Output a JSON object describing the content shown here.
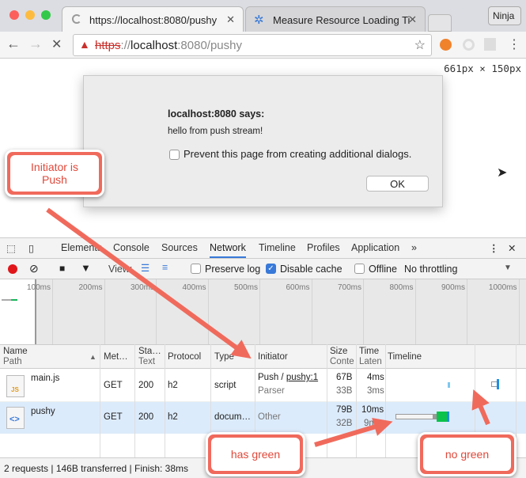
{
  "browser": {
    "tabs": [
      {
        "title": "https://localhost:8080/pushy"
      },
      {
        "title": "Measure Resource Loading Ti"
      }
    ],
    "profile": "Ninja",
    "url": {
      "scheme": "https",
      "host": "localhost",
      "rest": ":8080/pushy"
    },
    "viewport_size": "661px × 150px"
  },
  "dialog": {
    "title": "localhost:8080 says:",
    "message": "hello from push stream!",
    "checkbox_label": "Prevent this page from creating additional dialogs.",
    "ok": "OK"
  },
  "devtools": {
    "tabs": [
      "Elements",
      "Console",
      "Sources",
      "Network",
      "Timeline",
      "Profiles",
      "Application"
    ],
    "active_tab": "Network",
    "more": "»",
    "toolbar": {
      "view": "View:",
      "preserve_log": "Preserve log",
      "disable_cache": "Disable cache",
      "offline": "Offline",
      "throttling": "No throttling",
      "disable_cache_checked": true
    },
    "ticks": [
      "100ms",
      "200ms",
      "300ms",
      "400ms",
      "500ms",
      "600ms",
      "700ms",
      "800ms",
      "900ms",
      "1000ms"
    ],
    "columns": {
      "name": "Name",
      "path": "Path",
      "method": "Met…",
      "status": "Sta…",
      "status_text": "Text",
      "protocol": "Protocol",
      "type": "Type",
      "initiator": "Initiator",
      "size": "Size",
      "content": "Conte",
      "time": "Time",
      "latency": "Laten",
      "timeline": "Timeline"
    },
    "rows": [
      {
        "name": "main.js",
        "method": "GET",
        "status": "200",
        "protocol": "h2",
        "type": "script",
        "initiator_prefix": "Push / ",
        "initiator_link": "pushy:1",
        "initiator_sub": "Parser",
        "size": "67B",
        "content": "33B",
        "time": "4ms",
        "latency": "3ms"
      },
      {
        "name": "pushy",
        "method": "GET",
        "status": "200",
        "protocol": "h2",
        "type": "docum…",
        "initiator_prefix": "Other",
        "initiator_link": "",
        "initiator_sub": "",
        "size": "79B",
        "content": "32B",
        "time": "10ms",
        "latency": "9ms"
      }
    ],
    "status": "2 requests | 146B transferred | Finish: 38ms"
  },
  "annotations": {
    "initiator": "Initiator is Push",
    "has_green": "has green",
    "no_green": "no green",
    "color": "#f06a5c"
  }
}
